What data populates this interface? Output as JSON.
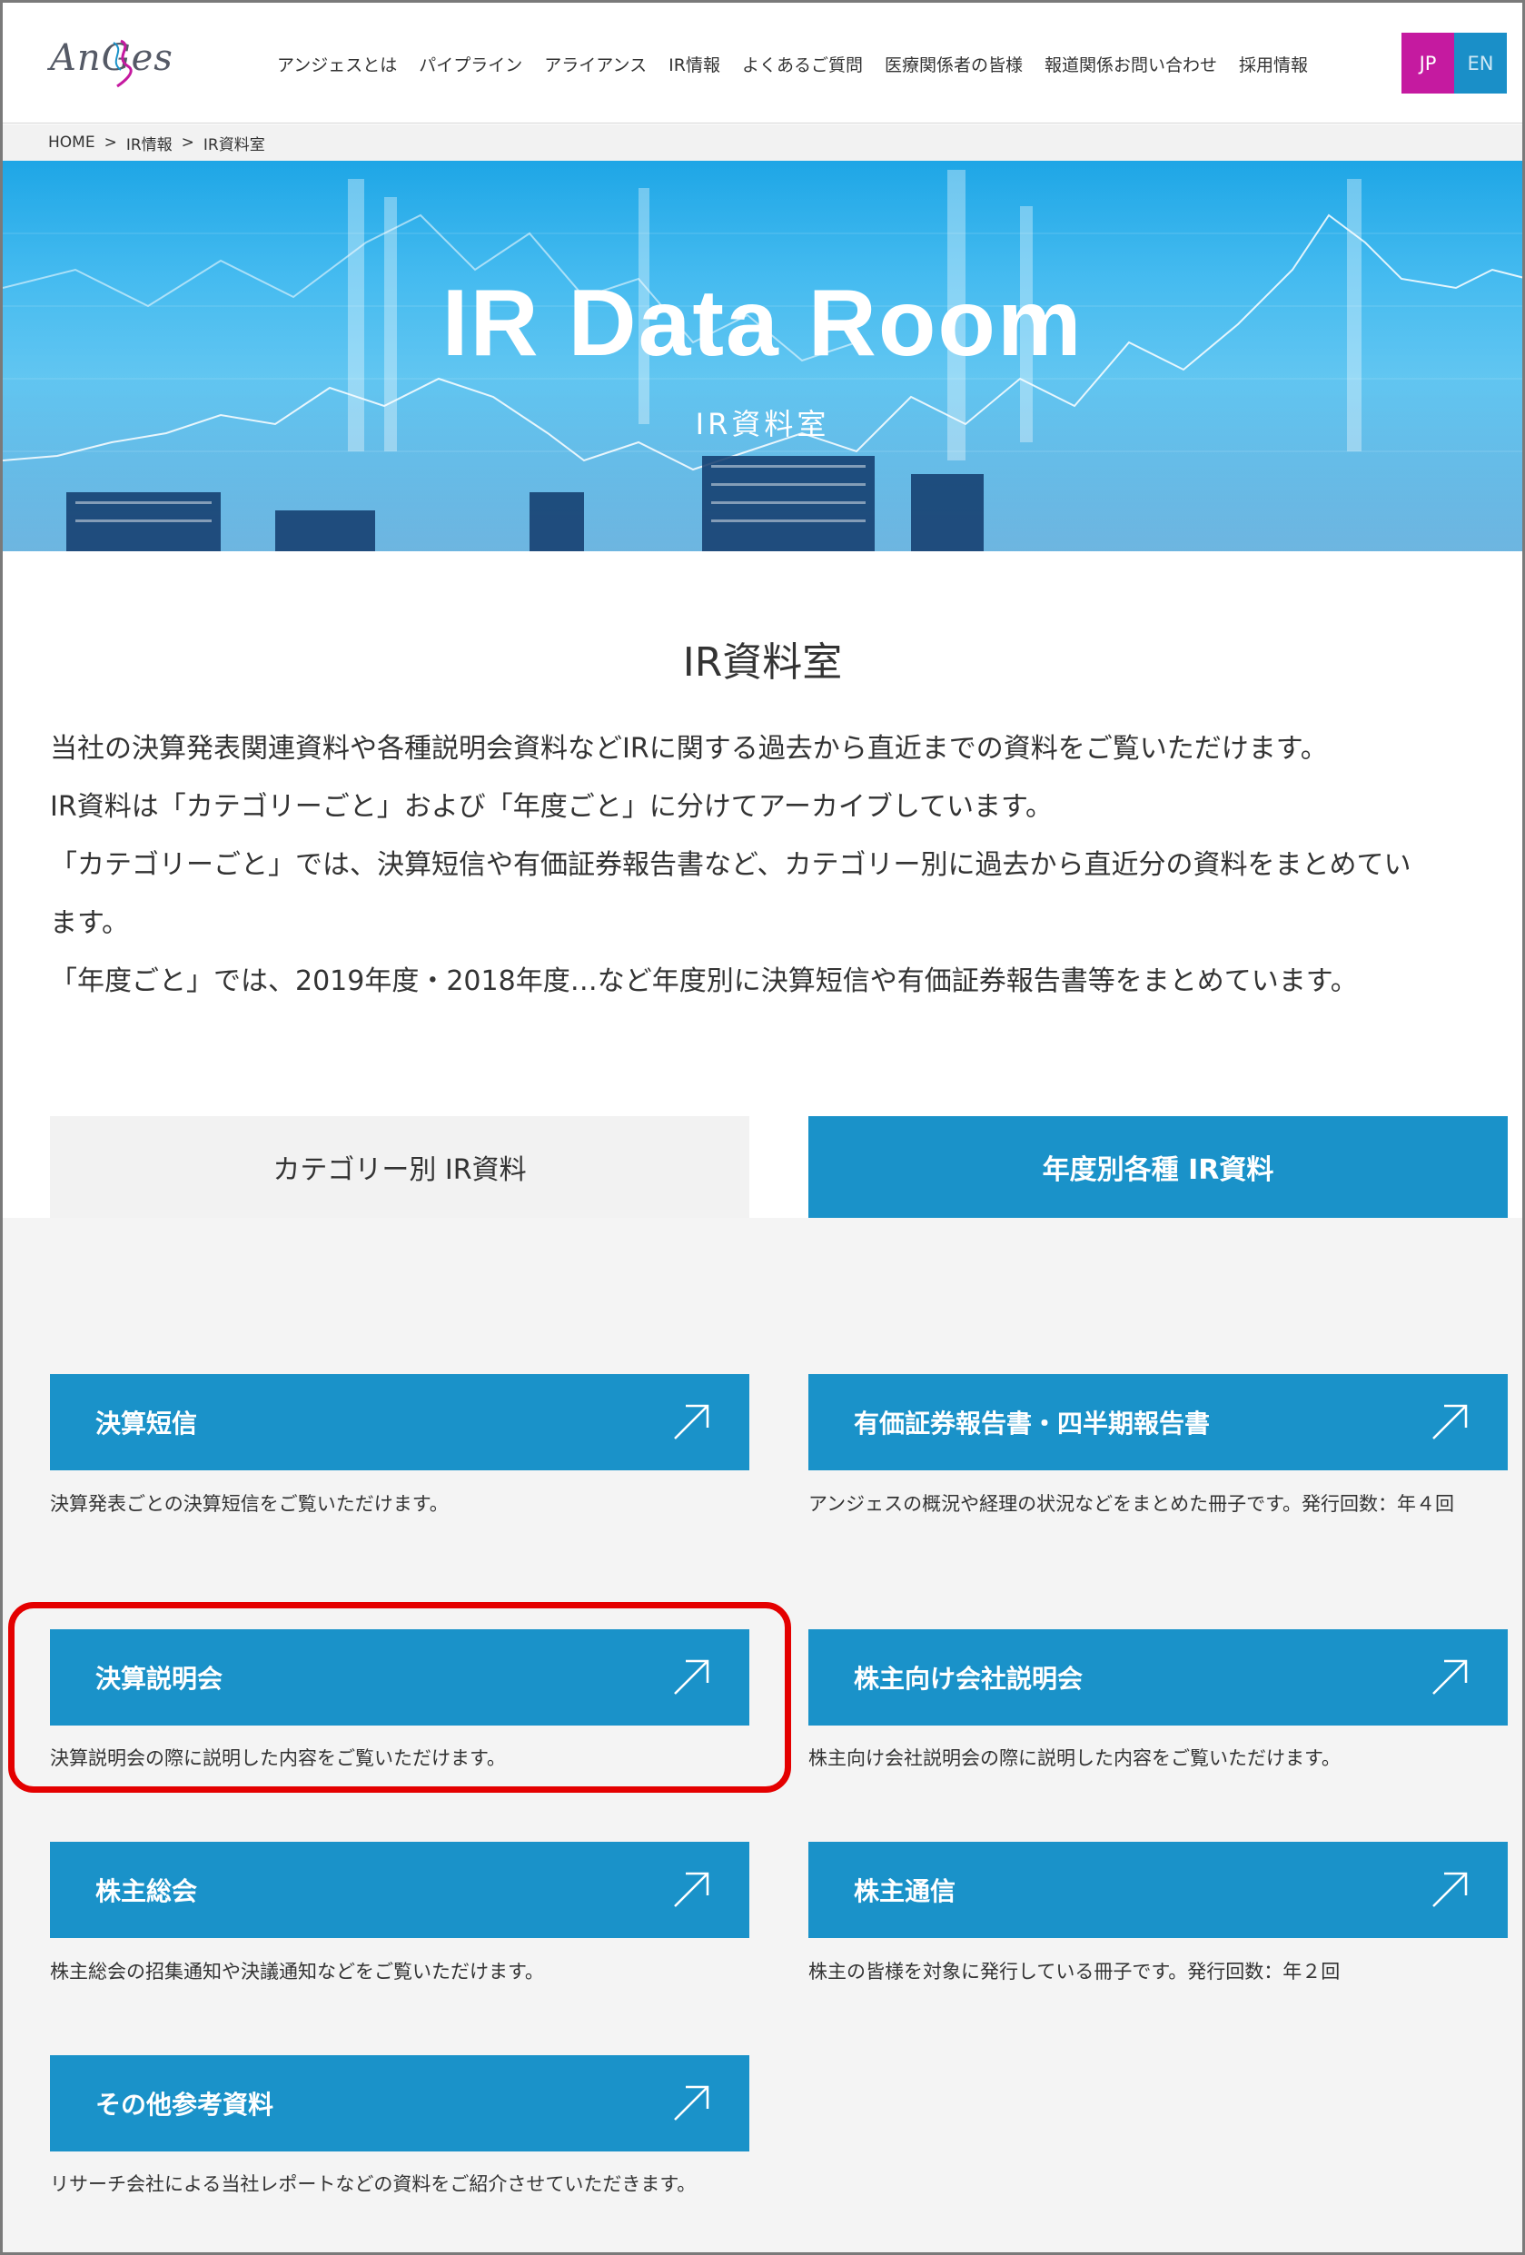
{
  "header": {
    "logo_text": "AnGes",
    "nav": [
      "アンジェスとは",
      "パイプライン",
      "アライアンス",
      "IR情報",
      "よくあるご質問",
      "医療関係者の皆様",
      "報道関係お問い合わせ",
      "採用情報"
    ],
    "lang_jp": "JP",
    "lang_en": "EN"
  },
  "breadcrumb": [
    "HOME",
    "IR情報",
    "IR資料室"
  ],
  "hero": {
    "title": "IR Data Room",
    "subtitle": "IR資料室"
  },
  "page_title": "IR資料室",
  "intro": [
    "当社の決算発表関連資料や各種説明会資料などIRに関する過去から直近までの資料をご覧いただけます。",
    "IR資料は「カテゴリーごと」および「年度ごと」に分けてアーカイブしています。",
    "「カテゴリーごと」では、決算短信や有価証券報告書など、カテゴリー別に過去から直近分の資料をまとめてい",
    "ます。",
    "「年度ごと」では、2019年度・2018年度…など年度別に決算短信や有価証券報告書等をまとめています。"
  ],
  "tabs": {
    "category": "カテゴリー別 IR資料",
    "year": "年度別各種 IR資料"
  },
  "cards": [
    {
      "label": "決算短信",
      "desc": "決算発表ごとの決算短信をご覧いただけます。"
    },
    {
      "label": "有価証券報告書・四半期報告書",
      "desc": "アンジェスの概況や経理の状況などをまとめた冊子です。発行回数：年４回"
    },
    {
      "label": "決算説明会",
      "desc": "決算説明会の際に説明した内容をご覧いただけます。"
    },
    {
      "label": "株主向け会社説明会",
      "desc": "株主向け会社説明会の際に説明した内容をご覧いただけます。"
    },
    {
      "label": "株主総会",
      "desc": "株主総会の招集通知や決議通知などをご覧いただけます。"
    },
    {
      "label": "株主通信",
      "desc": "株主の皆様を対象に発行している冊子です。発行回数：年２回"
    },
    {
      "label": "その他参考資料",
      "desc": "リサーチ会社による当社レポートなどの資料をご紹介させていただきます。"
    }
  ],
  "colors": {
    "accent_blue": "#1a92c9",
    "jp_magenta": "#c51aa0",
    "highlight_red": "#e40000"
  }
}
